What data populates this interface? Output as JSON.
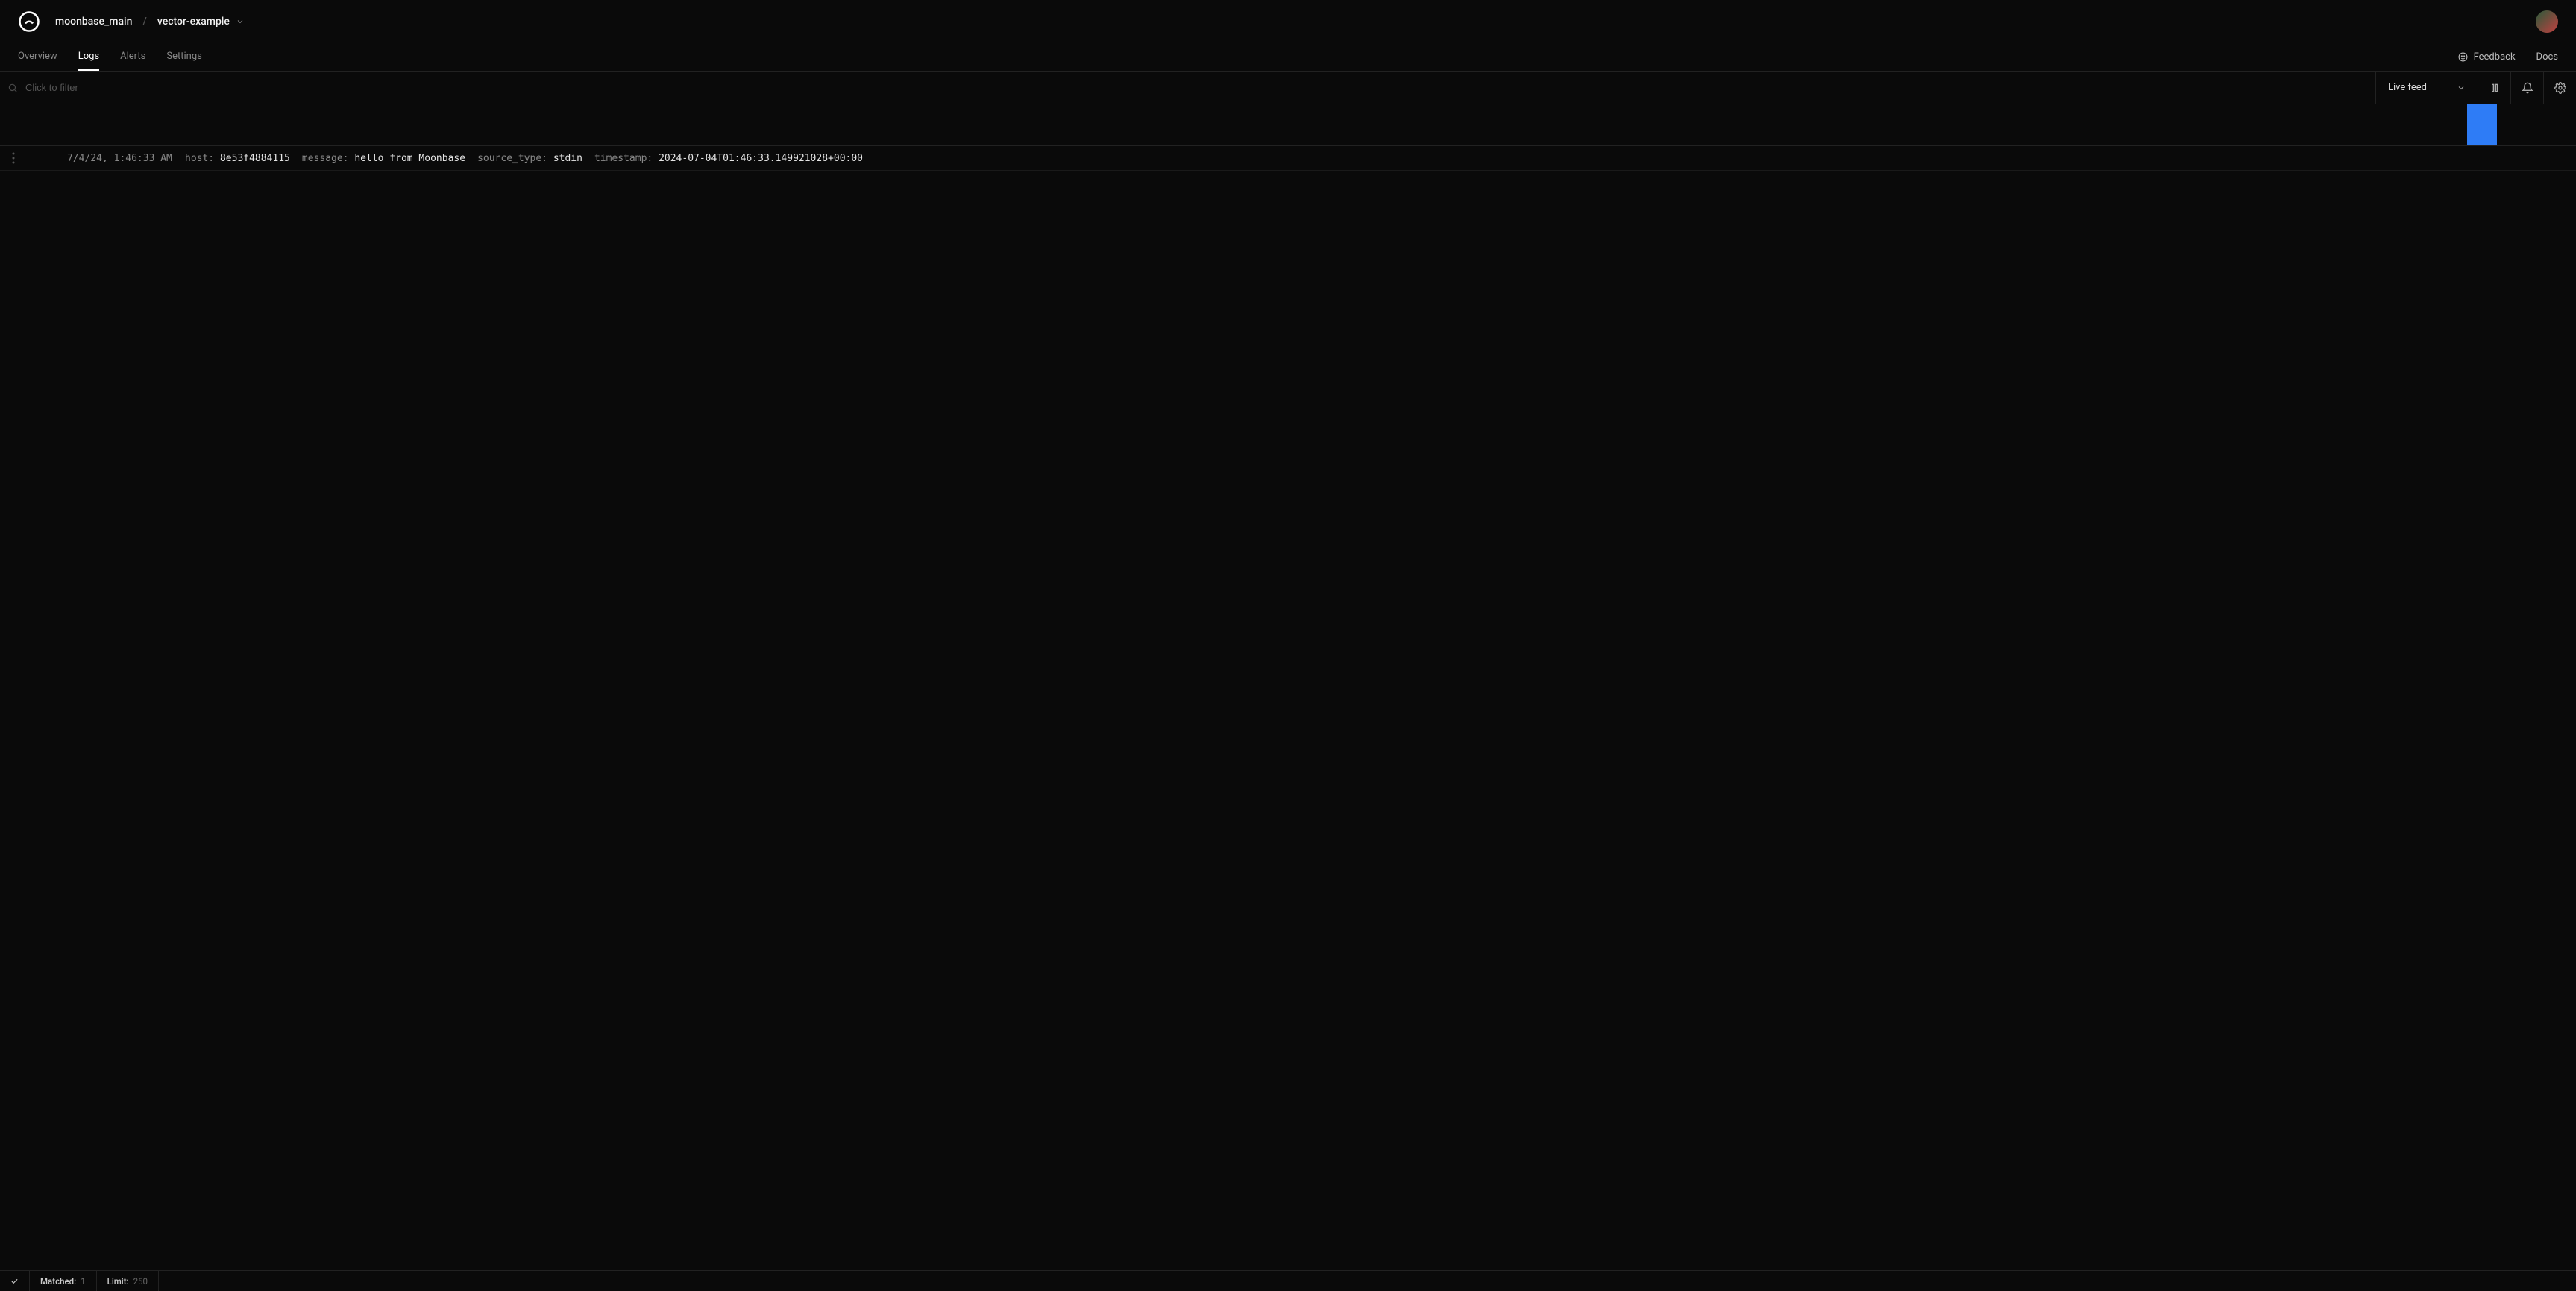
{
  "breadcrumb": {
    "workspace": "moonbase_main",
    "separator": "/",
    "project": "vector-example"
  },
  "tabs": {
    "overview": "Overview",
    "logs": "Logs",
    "alerts": "Alerts",
    "settings": "Settings"
  },
  "nav_right": {
    "feedback": "Feedback",
    "docs": "Docs"
  },
  "toolbar": {
    "search_placeholder": "Click to filter",
    "feed_label": "Live feed"
  },
  "logs": [
    {
      "timestamp_display": "7/4/24, 1:46:33 AM",
      "fields": {
        "host_key": "host:",
        "host_val": "8e53f4884115",
        "message_key": "message:",
        "message_val": "hello from Moonbase",
        "source_type_key": "source_type:",
        "source_type_val": "stdin",
        "timestamp_key": "timestamp:",
        "timestamp_val": "2024-07-04T01:46:33.149921028+00:00"
      }
    }
  ],
  "footer": {
    "matched_label": "Matched:",
    "matched_value": "1",
    "limit_label": "Limit:",
    "limit_value": "250"
  }
}
